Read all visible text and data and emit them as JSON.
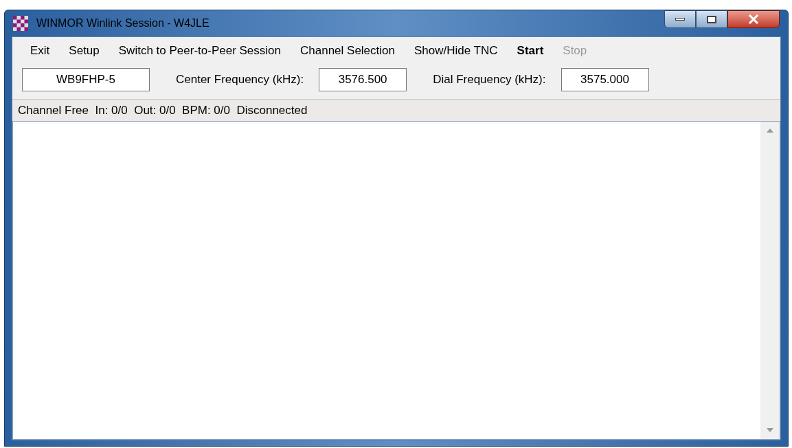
{
  "window": {
    "title": "WINMOR Winlink Session - W4JLE"
  },
  "menu": [
    {
      "label": "Exit",
      "bold": false,
      "disabled": false
    },
    {
      "label": "Setup",
      "bold": false,
      "disabled": false
    },
    {
      "label": "Switch to Peer-to-Peer Session",
      "bold": false,
      "disabled": false
    },
    {
      "label": "Channel Selection",
      "bold": false,
      "disabled": false
    },
    {
      "label": "Show/Hide TNC",
      "bold": false,
      "disabled": false
    },
    {
      "label": "Start",
      "bold": true,
      "disabled": false
    },
    {
      "label": "Stop",
      "bold": false,
      "disabled": true
    }
  ],
  "fields": [
    {
      "value": "WB9FHP-5"
    },
    {
      "label": "Center Frequency (kHz):",
      "value": "3576.500"
    },
    {
      "label": "Dial Frequency (kHz):",
      "value": "3575.000"
    }
  ],
  "status_bar": "Channel Free  In: 0/0  Out: 0/0  BPM: 0/0  Disconnected"
}
